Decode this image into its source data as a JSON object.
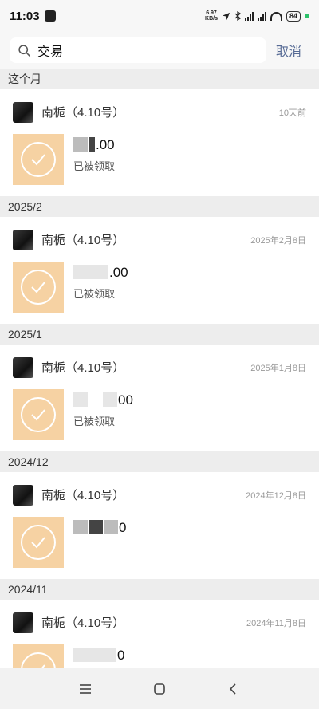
{
  "status_bar": {
    "time": "11:03",
    "net_speed_value": "6.97",
    "net_speed_unit": "KB/s",
    "battery": "84"
  },
  "search": {
    "value": "交易",
    "placeholder": "",
    "cancel_label": "取消"
  },
  "sections": [
    {
      "header": "这个月",
      "card": {
        "title": "南栀（4.10号）",
        "time": "10天前",
        "amount": ".00",
        "status": "已被领取"
      }
    },
    {
      "header": "2025/2",
      "card": {
        "title": "南栀（4.10号）",
        "time": "2025年2月8日",
        "amount": ".00",
        "status": "已被领取"
      }
    },
    {
      "header": "2025/1",
      "card": {
        "title": "南栀（4.10号）",
        "time": "2025年1月8日",
        "amount": "00",
        "status": "已被领取"
      }
    },
    {
      "header": "2024/12",
      "card": {
        "title": "南栀（4.10号）",
        "time": "2024年12月8日",
        "amount": "0",
        "status": ""
      }
    },
    {
      "header": "2024/11",
      "card": {
        "title": "南栀（4.10号）",
        "time": "2024年11月8日",
        "amount": "0",
        "status": ""
      }
    }
  ],
  "icons": {
    "search": "search-icon",
    "check": "check-icon",
    "menu": "menu-icon",
    "home": "home-icon",
    "back": "back-icon"
  },
  "colors": {
    "packet": "#f6d2a3",
    "link": "#576b95",
    "battery_dot": "#2ec26b"
  }
}
